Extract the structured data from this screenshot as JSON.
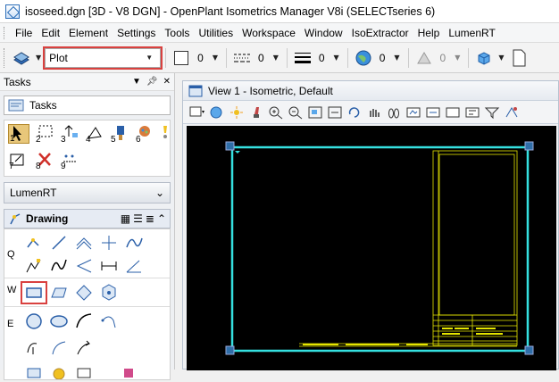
{
  "window": {
    "title": "isoseed.dgn [3D - V8 DGN] - OpenPlant Isometrics Manager V8i (SELECTseries 6)",
    "app_icon": "microstation-icon"
  },
  "menu": {
    "items": [
      "File",
      "Edit",
      "Element",
      "Settings",
      "Tools",
      "Utilities",
      "Workspace",
      "Window",
      "IsoExtractor",
      "Help",
      "LumenRT"
    ]
  },
  "toolbar": {
    "level_combo_value": "Plot",
    "color_value": "0",
    "style_value": "0",
    "weight_value": "0",
    "transparency_value": "0",
    "priority_value": "0",
    "highlight_color": "#d9413f"
  },
  "tasks": {
    "panel_title": "Tasks",
    "dropdown_label": "Tasks",
    "grid_labels": [
      "1",
      "2",
      "3",
      "4",
      "5",
      "6",
      "7",
      "8",
      "9"
    ],
    "group_lumenrt": "LumenRT",
    "group_drawing": "Drawing",
    "row_letters": [
      "Q",
      "W",
      "E"
    ]
  },
  "view": {
    "title": "View 1 - Isometric, Default",
    "border_color": "#35e0e0",
    "detail_color": "#e6e600"
  }
}
